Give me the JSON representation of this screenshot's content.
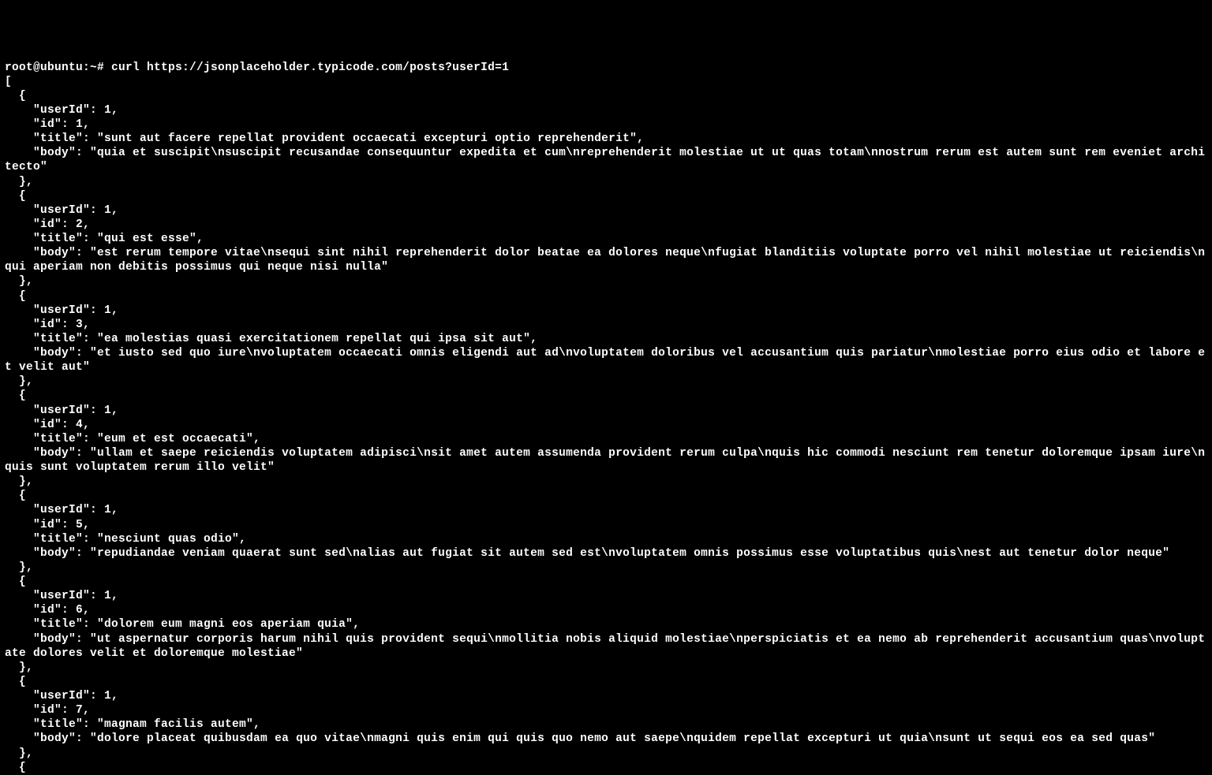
{
  "prompt": "root@ubuntu:~# ",
  "command": "curl https://jsonplaceholder.typicode.com/posts?userId=1",
  "output_open": "[",
  "posts": [
    {
      "userId": 1,
      "id": 1,
      "title": "sunt aut facere repellat provident occaecati excepturi optio reprehenderit",
      "body": "quia et suscipit\\nsuscipit recusandae consequuntur expedita et cum\\nreprehenderit molestiae ut ut quas totam\\nnostrum rerum est autem sunt rem eveniet architecto"
    },
    {
      "userId": 1,
      "id": 2,
      "title": "qui est esse",
      "body": "est rerum tempore vitae\\nsequi sint nihil reprehenderit dolor beatae ea dolores neque\\nfugiat blanditiis voluptate porro vel nihil molestiae ut reiciendis\\nqui aperiam non debitis possimus qui neque nisi nulla"
    },
    {
      "userId": 1,
      "id": 3,
      "title": "ea molestias quasi exercitationem repellat qui ipsa sit aut",
      "body": "et iusto sed quo iure\\nvoluptatem occaecati omnis eligendi aut ad\\nvoluptatem doloribus vel accusantium quis pariatur\\nmolestiae porro eius odio et labore et velit aut"
    },
    {
      "userId": 1,
      "id": 4,
      "title": "eum et est occaecati",
      "body": "ullam et saepe reiciendis voluptatem adipisci\\nsit amet autem assumenda provident rerum culpa\\nquis hic commodi nesciunt rem tenetur doloremque ipsam iure\\nquis sunt voluptatem rerum illo velit"
    },
    {
      "userId": 1,
      "id": 5,
      "title": "nesciunt quas odio",
      "body": "repudiandae veniam quaerat sunt sed\\nalias aut fugiat sit autem sed est\\nvoluptatem omnis possimus esse voluptatibus quis\\nest aut tenetur dolor neque"
    },
    {
      "userId": 1,
      "id": 6,
      "title": "dolorem eum magni eos aperiam quia",
      "body": "ut aspernatur corporis harum nihil quis provident sequi\\nmollitia nobis aliquid molestiae\\nperspiciatis et ea nemo ab reprehenderit accusantium quas\\nvoluptate dolores velit et doloremque molestiae"
    },
    {
      "userId": 1,
      "id": 7,
      "title": "magnam facilis autem",
      "body": "dolore placeat quibusdam ea quo vitae\\nmagni quis enim qui quis quo nemo aut saepe\\nquidem repellat excepturi ut quia\\nsunt ut sequi eos ea sed quas"
    }
  ],
  "trailing_open": "  {"
}
